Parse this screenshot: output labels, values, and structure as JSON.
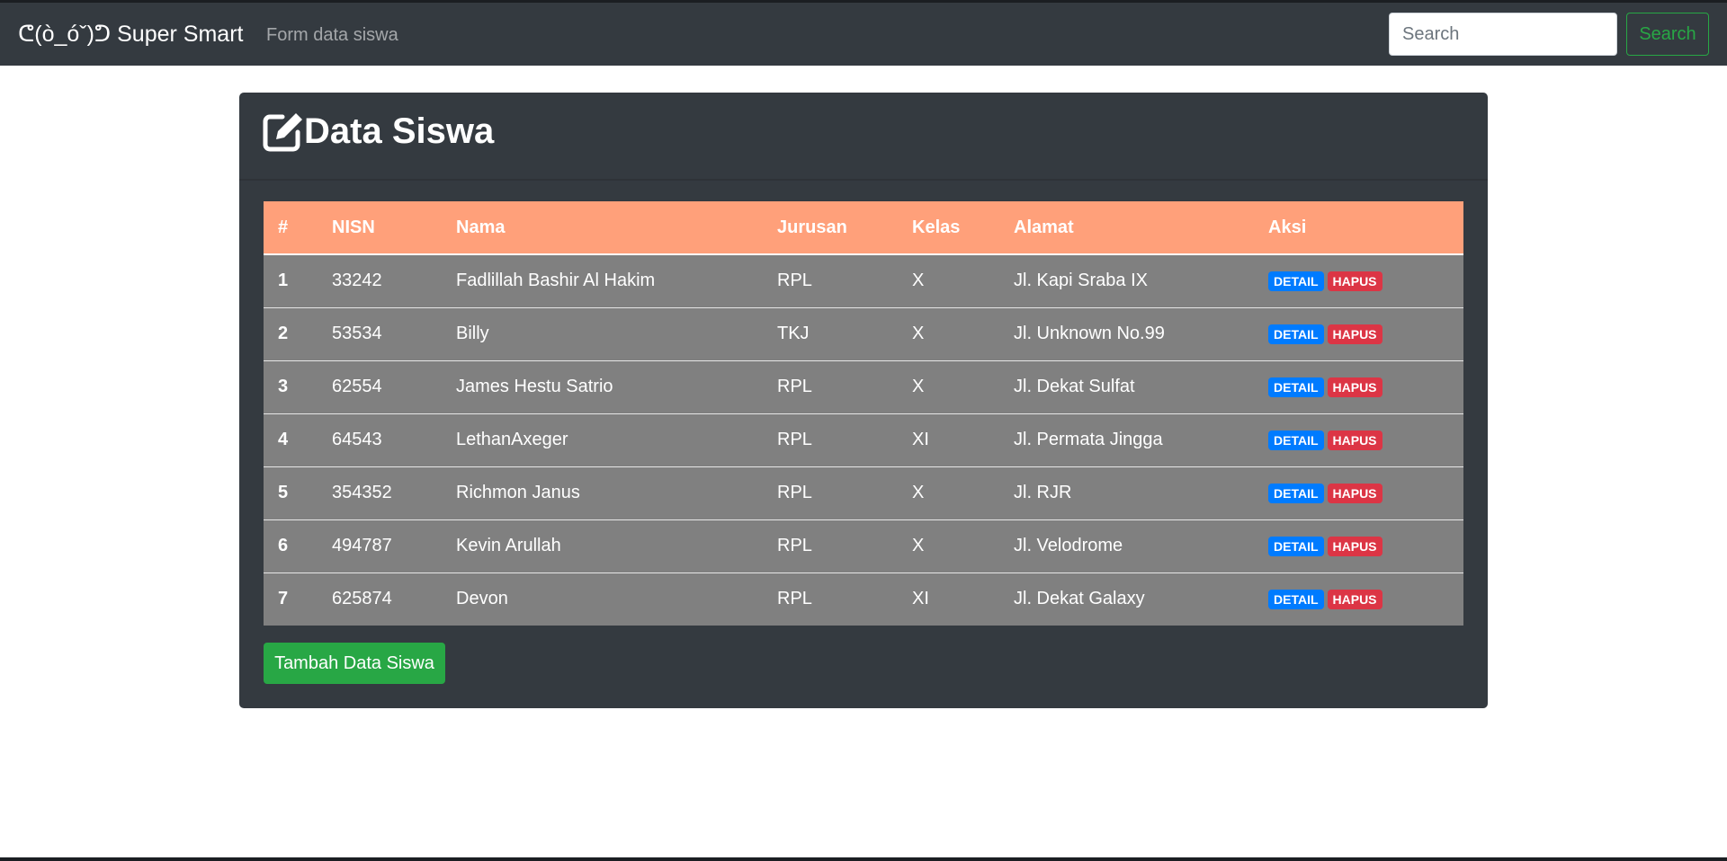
{
  "navbar": {
    "brand": "ᕦ(ò_óˇ)ᕤ Super Smart",
    "link": "Form data siswa",
    "search_placeholder": "Search",
    "search_button": "Search"
  },
  "card": {
    "title": "Data Siswa",
    "title_icon": "edit-icon",
    "add_button": "Tambah Data Siswa"
  },
  "table": {
    "headers": [
      "#",
      "NISN",
      "Nama",
      "Jurusan",
      "Kelas",
      "Alamat",
      "Aksi"
    ],
    "rows": [
      {
        "no": "1",
        "nisn": "33242",
        "nama": "Fadlillah Bashir Al Hakim",
        "jurusan": "RPL",
        "kelas": "X",
        "alamat": "Jl. Kapi Sraba IX"
      },
      {
        "no": "2",
        "nisn": "53534",
        "nama": "Billy",
        "jurusan": "TKJ",
        "kelas": "X",
        "alamat": "Jl. Unknown No.99"
      },
      {
        "no": "3",
        "nisn": "62554",
        "nama": "James Hestu Satrio",
        "jurusan": "RPL",
        "kelas": "X",
        "alamat": "Jl. Dekat Sulfat"
      },
      {
        "no": "4",
        "nisn": "64543",
        "nama": "LethanAxeger",
        "jurusan": "RPL",
        "kelas": "XI",
        "alamat": "Jl. Permata Jingga"
      },
      {
        "no": "5",
        "nisn": "354352",
        "nama": "Richmon Janus",
        "jurusan": "RPL",
        "kelas": "X",
        "alamat": "Jl. RJR"
      },
      {
        "no": "6",
        "nisn": "494787",
        "nama": "Kevin Arullah",
        "jurusan": "RPL",
        "kelas": "X",
        "alamat": "Jl. Velodrome"
      },
      {
        "no": "7",
        "nisn": "625874",
        "nama": "Devon",
        "jurusan": "RPL",
        "kelas": "XI",
        "alamat": "Jl. Dekat Galaxy"
      }
    ],
    "detail_label": "DETAIL",
    "hapus_label": "HAPUS"
  },
  "colors": {
    "navbar_bg": "#343a40",
    "table_header_bg": "#ffa07a",
    "row_bg": "#808080",
    "detail": "#007bff",
    "hapus": "#dc3545",
    "success": "#28a745"
  }
}
